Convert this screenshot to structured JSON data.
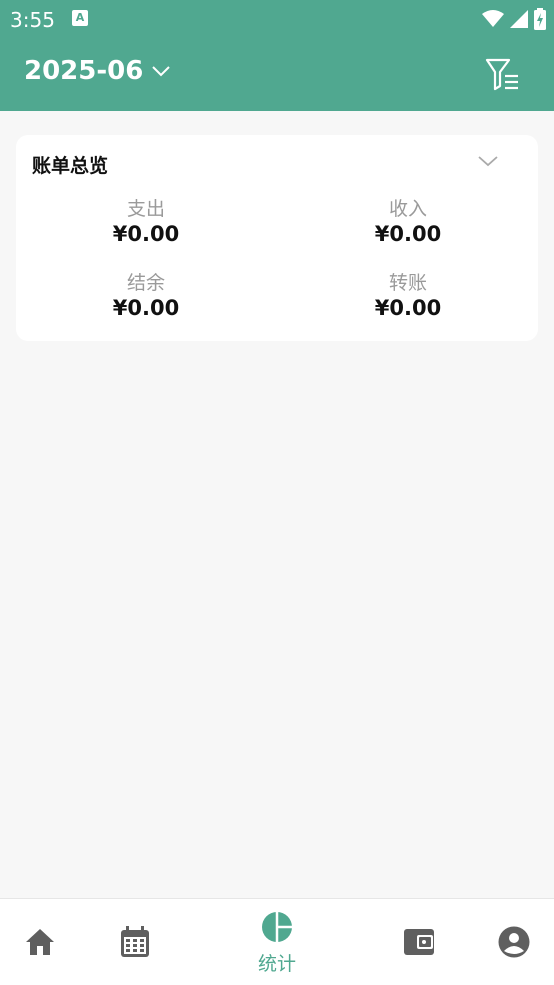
{
  "status_bar": {
    "time": "3:55",
    "notification_icon": "A"
  },
  "header": {
    "month": "2025-06"
  },
  "overview": {
    "title": "账单总览",
    "stats": [
      {
        "label": "支出",
        "value": "¥0.00"
      },
      {
        "label": "收入",
        "value": "¥0.00"
      },
      {
        "label": "结余",
        "value": "¥0.00"
      },
      {
        "label": "转账",
        "value": "¥0.00"
      }
    ]
  },
  "tabbar": {
    "active_label": "统计",
    "tabs": [
      "home-icon",
      "calendar-icon",
      "pie-chart-icon",
      "wallet-icon",
      "account-icon"
    ]
  },
  "colors": {
    "accent": "#50a890",
    "icon_inactive": "#5f5f5f"
  }
}
